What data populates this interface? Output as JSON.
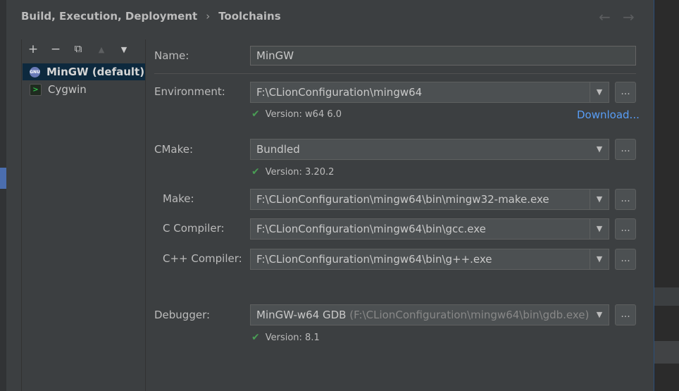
{
  "breadcrumb": {
    "section": "Build, Execution, Deployment",
    "separator": "›",
    "page": "Toolchains"
  },
  "nav": {
    "back": "←",
    "forward": "→"
  },
  "toolbar": {
    "add": "+",
    "remove": "−",
    "copy": "⧉",
    "up": "▲",
    "down": "▼"
  },
  "toolchains": [
    {
      "label": "MinGW (default)",
      "icon": "gnu-icon",
      "icon_text": "GNU",
      "selected": true
    },
    {
      "label": "Cygwin",
      "icon": "cygwin-icon",
      "icon_text": ">",
      "selected": false
    }
  ],
  "form": {
    "name_label": "Name:",
    "name_value": "MinGW",
    "environment_label": "Environment:",
    "environment_value": "F:\\CLionConfiguration\\mingw64",
    "environment_version": "Version: w64 6.0",
    "download_link": "Download...",
    "cmake_label": "CMake:",
    "cmake_value": "Bundled",
    "cmake_version": "Version: 3.20.2",
    "make_label": "Make:",
    "make_value": "F:\\CLionConfiguration\\mingw64\\bin\\mingw32-make.exe",
    "c_compiler_label": "C Compiler:",
    "c_compiler_value": "F:\\CLionConfiguration\\mingw64\\bin\\gcc.exe",
    "cpp_compiler_label": "C++ Compiler:",
    "cpp_compiler_value": "F:\\CLionConfiguration\\mingw64\\bin\\g++.exe",
    "debugger_label": "Debugger:",
    "debugger_name": "MinGW-w64 GDB",
    "debugger_path": "(F:\\CLionConfiguration\\mingw64\\bin\\gdb.exe)",
    "debugger_version": "Version: 8.1",
    "browse": "...",
    "check": "✔",
    "dropdown": "▼"
  },
  "colors": {
    "background": "#3c3f41",
    "selection": "#0d293e",
    "link": "#589df6",
    "check": "#499c54"
  }
}
